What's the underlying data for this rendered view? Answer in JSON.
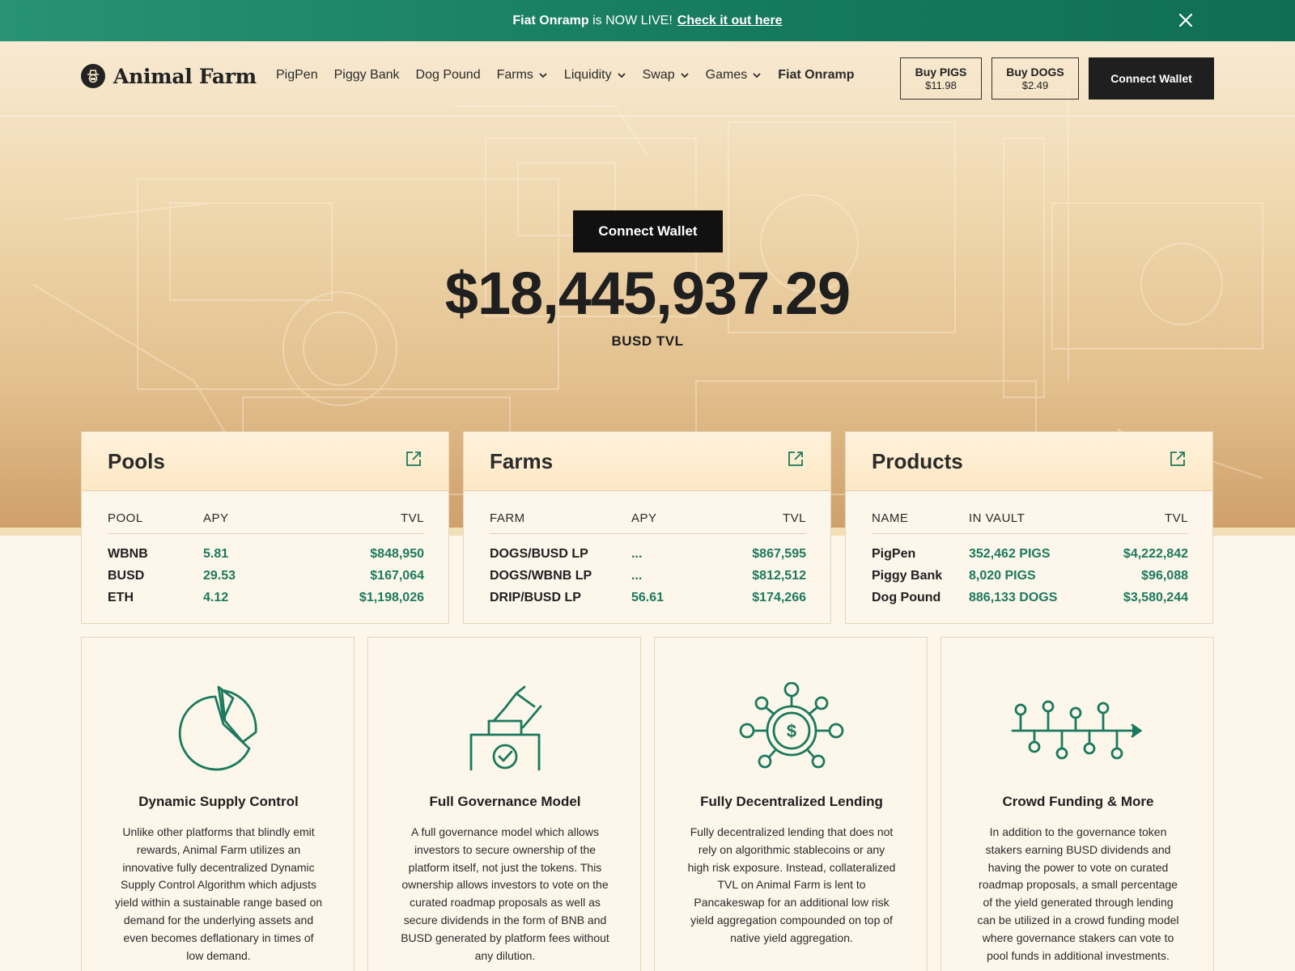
{
  "banner": {
    "bold_text": "Fiat Onramp",
    "middle_text": " is NOW LIVE!",
    "link_text": "Check it out here"
  },
  "header": {
    "logo_text": "Animal Farm",
    "nav": [
      {
        "label": "PigPen"
      },
      {
        "label": "Piggy Bank"
      },
      {
        "label": "Dog Pound"
      },
      {
        "label": "Farms"
      },
      {
        "label": "Liquidity"
      },
      {
        "label": "Swap"
      },
      {
        "label": "Games"
      },
      {
        "label": "Fiat Onramp"
      }
    ],
    "buy_pigs": {
      "label": "Buy PIGS",
      "price": "$11.98"
    },
    "buy_dogs": {
      "label": "Buy DOGS",
      "price": "$2.49"
    },
    "connect_label": "Connect Wallet"
  },
  "hero": {
    "connect_label": "Connect Wallet",
    "tvl_value": "$18,445,937.29",
    "tvl_label": "BUSD TVL"
  },
  "pools": {
    "title": "Pools",
    "headers": [
      "POOL",
      "APY",
      "TVL"
    ],
    "rows": [
      [
        "WBNB",
        "5.81",
        "$848,950"
      ],
      [
        "BUSD",
        "29.53",
        "$167,064"
      ],
      [
        "ETH",
        "4.12",
        "$1,198,026"
      ]
    ]
  },
  "farms": {
    "title": "Farms",
    "headers": [
      "FARM",
      "APY",
      "TVL"
    ],
    "rows": [
      [
        "DOGS/BUSD LP",
        "...",
        "$867,595"
      ],
      [
        "DOGS/WBNB LP",
        "...",
        "$812,512"
      ],
      [
        "DRIP/BUSD LP",
        "56.61",
        "$174,266"
      ]
    ]
  },
  "products": {
    "title": "Products",
    "headers": [
      "NAME",
      "IN VAULT",
      "TVL"
    ],
    "rows": [
      [
        "PigPen",
        "352,462 PIGS",
        "$4,222,842"
      ],
      [
        "Piggy Bank",
        "8,020 PIGS",
        "$96,088"
      ],
      [
        "Dog Pound",
        "886,133 DOGS",
        "$3,580,244"
      ]
    ]
  },
  "features": [
    {
      "title": "Dynamic Supply Control",
      "text": "Unlike other platforms that blindly emit rewards, Animal Farm utilizes an innovative fully decentralized Dynamic Supply Control Algorithm which adjusts yield within a sustainable range based on demand for the underlying assets and even becomes deflationary in times of low demand.",
      "icon": "pie-chart-icon"
    },
    {
      "title": "Full Governance Model",
      "text": "A full governance model which allows investors to secure ownership of the platform itself, not just the tokens. This ownership allows investors to vote on the curated roadmap proposals as well as secure dividends in the form of BNB and BUSD generated by platform fees without any dilution.",
      "icon": "ballot-box-icon"
    },
    {
      "title": "Fully Decentralized Lending",
      "text": "Fully decentralized lending that does not rely on algorithmic stablecoins or any high risk exposure. Instead, collateralized TVL on Animal Farm is lent to Pancakeswap for an additional low risk yield aggregation compounded on top of native yield aggregation.",
      "icon": "dollar-network-icon"
    },
    {
      "title": "Crowd Funding & More",
      "text": "In addition to the governance token stakers earning BUSD dividends and having the power to vote on curated roadmap proposals, a small percentage of the yield generated through lending can be utilized in a crowd funding model where governance stakers can vote to pool funds in additional investments.",
      "icon": "timeline-icon"
    }
  ],
  "colors": {
    "accent_green": "#1b7a5d",
    "banner_green": "#15795d",
    "dark": "#1f1f1f",
    "cream": "#fdf6ea"
  }
}
